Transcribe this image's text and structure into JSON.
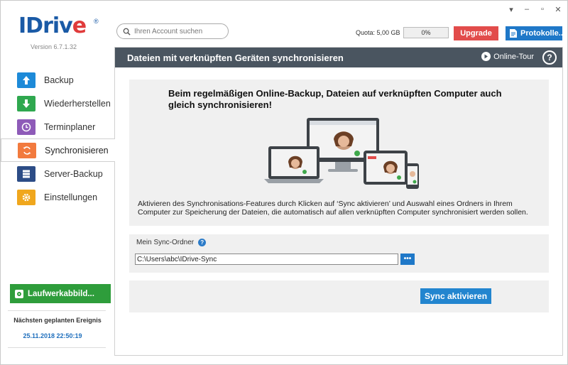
{
  "window": {
    "controls": [
      "▾",
      "–",
      "▫",
      "✕"
    ]
  },
  "logo": {
    "prefix": "IDriv",
    "e": "e",
    "reg": "®",
    "version": "Version 6.7.1.32"
  },
  "search": {
    "placeholder": "Ihren Account suchen"
  },
  "quota": {
    "label": "Quota: 5,00 GB",
    "percent_text": "0%",
    "percent": 0
  },
  "header_buttons": {
    "upgrade": "Upgrade",
    "protocols": "Protokolle..."
  },
  "sidebar": {
    "items": [
      {
        "label": "Backup",
        "icon": "arrow-up-icon",
        "color": "#1d8ad8"
      },
      {
        "label": "Wiederherstellen",
        "icon": "arrow-down-icon",
        "color": "#2fa84f"
      },
      {
        "label": "Terminplaner",
        "icon": "clock-icon",
        "color": "#8e5bb8"
      },
      {
        "label": "Synchronisieren",
        "icon": "sync-icon",
        "color": "#f27a3e"
      },
      {
        "label": "Server-Backup",
        "icon": "server-icon",
        "color": "#2c4c86"
      },
      {
        "label": "Einstellungen",
        "icon": "gear-icon",
        "color": "#f0a71d"
      }
    ],
    "drive_button": "Laufwerkabbild...",
    "next_event_label": "Nächsten geplanten Ereignis",
    "next_event_date": "25.11.2018 22:50:19"
  },
  "main": {
    "title": "Dateien mit verknüpften Geräten synchronisieren",
    "tour": "Online-Tour",
    "help": "?",
    "promo_title": "Beim regelmäßigen Online-Backup, Dateien auf verknüpften Computer auch gleich synchronisieren!",
    "promo_desc": "Aktivieren des Synchronisations-Features durch Klicken auf ‘Sync aktivieren’ und Auswahl eines Ordners in Ihrem Computer zur Speicherung der Dateien, die automatisch auf allen verknüpften Computer synchronisiert werden sollen.",
    "sync_folder_label": "Mein Sync-Ordner",
    "sync_folder_value": "C:\\Users\\abc\\IDrive-Sync",
    "browse": "•••",
    "sync_button": "Sync aktivieren"
  },
  "colors": {
    "accent": "#1f78c8",
    "upgrade": "#e24c4b",
    "header": "#4a5560",
    "drive": "#2e9d3b"
  }
}
